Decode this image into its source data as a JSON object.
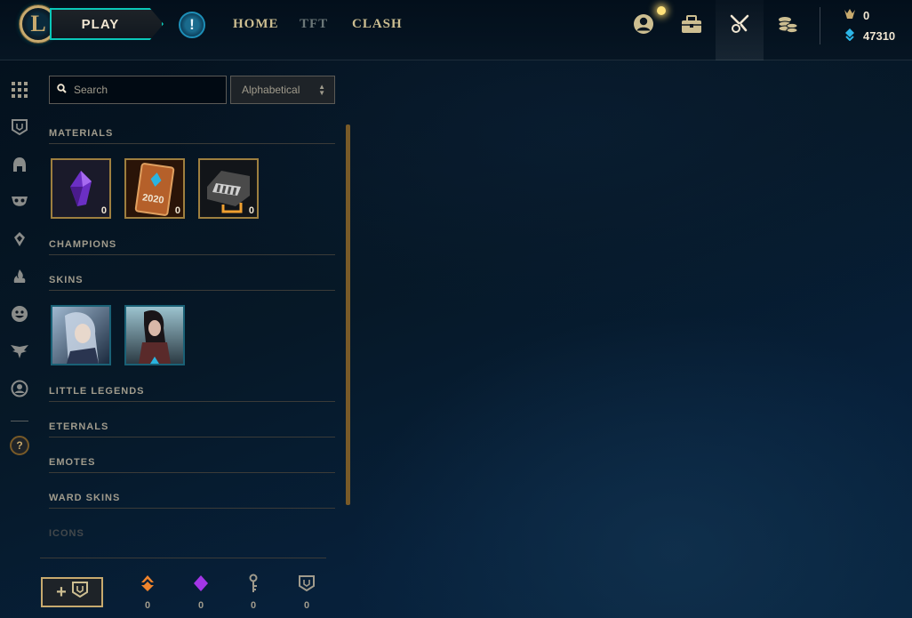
{
  "topbar": {
    "logo_letter": "L",
    "play_label": "PLAY",
    "alert_glyph": "!",
    "nav": [
      {
        "label": "HOME",
        "active": true
      },
      {
        "label": "TFT",
        "active": false
      },
      {
        "label": "CLASH",
        "active": true
      }
    ],
    "icons": [
      "profile-icon",
      "loot-icon",
      "collection-icon",
      "store-icon"
    ],
    "currencies": [
      {
        "name": "orange-essence-icon",
        "value": "0"
      },
      {
        "name": "blue-essence-icon",
        "value": "47310"
      }
    ]
  },
  "rail": {
    "icons": [
      "grid-icon",
      "ward-icon",
      "champions-icon",
      "skins-mask-icon",
      "eternals-icon",
      "fire-icon",
      "emote-icon",
      "little-legend-icon",
      "profile-icon"
    ],
    "help_glyph": "?"
  },
  "panel": {
    "search_placeholder": "Search",
    "sort_value": "Alphabetical",
    "sections": {
      "materials": "MATERIALS",
      "champions": "CHAMPIONS",
      "skins": "SKINS",
      "little_legends": "LITTLE LEGENDS",
      "eternals": "ETERNALS",
      "emotes": "EMOTES",
      "ward_skins": "WARD SKINS",
      "icons": "ICONS"
    },
    "materials": [
      {
        "name": "mythic-essence",
        "count": "0"
      },
      {
        "name": "event-pass-2020",
        "label": "2020",
        "count": "0"
      },
      {
        "name": "hextech-chest",
        "count": "0"
      }
    ],
    "skins": [
      {
        "name": "skin-portrait-1"
      },
      {
        "name": "skin-portrait-2"
      }
    ]
  },
  "footer": {
    "add_label": "+",
    "resources": [
      {
        "name": "orange-shard-icon",
        "value": "0",
        "color": "#f0842c"
      },
      {
        "name": "purple-gem-icon",
        "value": "0",
        "color": "#a336e6"
      },
      {
        "name": "key-icon",
        "value": "0",
        "color": "#a09b8c"
      },
      {
        "name": "ward-icon",
        "value": "0",
        "color": "#a09b8c"
      }
    ]
  },
  "colors": {
    "gold": "#c8aa6e",
    "teal": "#0ac8b9",
    "text_muted": "#a09b8c"
  }
}
